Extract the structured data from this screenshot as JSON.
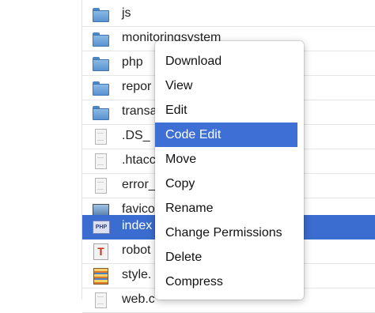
{
  "file_list": {
    "rows": [
      {
        "name": "js",
        "icon": "folder-icon",
        "selected": false
      },
      {
        "name": "monitoringsystem",
        "icon": "folder-icon",
        "selected": false
      },
      {
        "name": "php",
        "icon": "folder-icon",
        "selected": false
      },
      {
        "name": "repor",
        "icon": "folder-icon",
        "selected": false
      },
      {
        "name": "transa",
        "icon": "folder-icon",
        "selected": false
      },
      {
        "name": ".DS_",
        "icon": "document-icon",
        "selected": false
      },
      {
        "name": ".htacc",
        "icon": "document-icon",
        "selected": false
      },
      {
        "name": "error_",
        "icon": "document-icon",
        "selected": false
      },
      {
        "name": "favico",
        "icon": "image-icon",
        "selected": false
      },
      {
        "name": "index",
        "icon": "php-file-icon",
        "selected": true
      },
      {
        "name": "robot",
        "icon": "text-file-icon",
        "selected": false
      },
      {
        "name": "style.",
        "icon": "stylesheet-icon",
        "selected": false
      },
      {
        "name": "web.c",
        "icon": "document-icon",
        "selected": false
      }
    ],
    "selected_color": "#3b6ccf"
  },
  "context_menu": {
    "items": [
      {
        "label": "Download"
      },
      {
        "label": "View"
      },
      {
        "label": "Edit"
      },
      {
        "label": "Code Edit",
        "highlighted": true
      },
      {
        "label": "Move"
      },
      {
        "label": "Copy"
      },
      {
        "label": "Rename"
      },
      {
        "label": "Change Permissions"
      },
      {
        "label": "Delete"
      },
      {
        "label": "Compress"
      }
    ],
    "highlight_color": "#3e6fd4"
  }
}
